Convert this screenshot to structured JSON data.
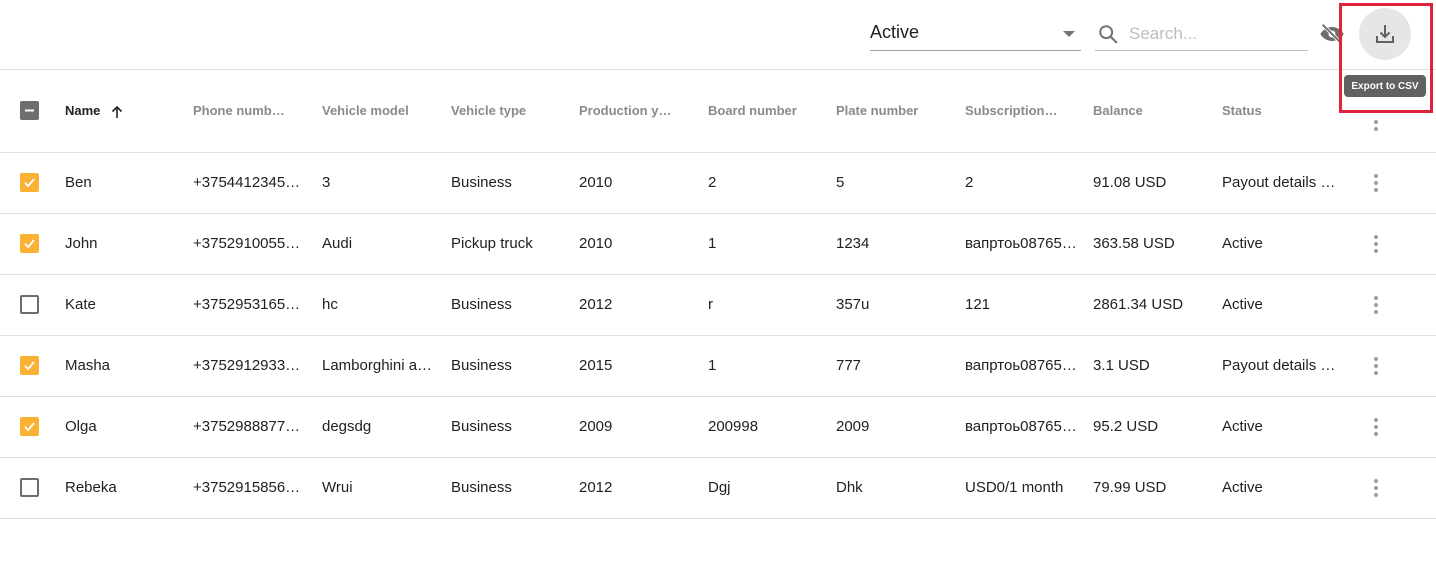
{
  "toolbar": {
    "status_filter": {
      "value": "Active"
    },
    "search": {
      "placeholder": "Search...",
      "value": ""
    },
    "hide_columns_icon": "eye-off-icon",
    "export_icon": "download-icon",
    "export_tooltip": "Export to CSV",
    "highlight_color": "#e0223a"
  },
  "table": {
    "columns": [
      "Name",
      "Phone numb…",
      "Vehicle model",
      "Vehicle type",
      "Production y…",
      "Board number",
      "Plate number",
      "Subscription…",
      "Balance",
      "Status"
    ],
    "sort": {
      "column": "Name",
      "direction": "ascending"
    },
    "select_all_state": "indeterminate",
    "checkbox_color": "#f9b233",
    "rows": [
      {
        "selected": true,
        "name": "Ben",
        "phone": "+3754412345…",
        "model": "3",
        "type": "Business",
        "year": "2010",
        "board": "2",
        "plate": "5",
        "subscription": "2",
        "balance": "91.08 USD",
        "status": "Payout details …"
      },
      {
        "selected": true,
        "name": "John",
        "phone": "+3752910055…",
        "model": "Audi",
        "type": "Pickup truck",
        "year": "2010",
        "board": "1",
        "plate": "1234",
        "subscription": "вапртоь08765…",
        "balance": "363.58 USD",
        "status": "Active"
      },
      {
        "selected": false,
        "name": "Kate",
        "phone": "+3752953165…",
        "model": "hc",
        "type": "Business",
        "year": "2012",
        "board": "r",
        "plate": "357u",
        "subscription": "121",
        "balance": "2861.34 USD",
        "status": "Active"
      },
      {
        "selected": true,
        "name": "Masha",
        "phone": "+3752912933…",
        "model": "Lamborghini a…",
        "type": "Business",
        "year": "2015",
        "board": "1",
        "plate": "777",
        "subscription": "вапртоь08765…",
        "balance": "3.1 USD",
        "status": "Payout details …"
      },
      {
        "selected": true,
        "name": "Olga",
        "phone": "+3752988877…",
        "model": "degsdg",
        "type": "Business",
        "year": "2009",
        "board": "200998",
        "plate": "2009",
        "subscription": "вапртоь08765…",
        "balance": "95.2 USD",
        "status": "Active"
      },
      {
        "selected": false,
        "name": "Rebeka",
        "phone": "+3752915856…",
        "model": "Wrui",
        "type": "Business",
        "year": "2012",
        "board": "Dgj",
        "plate": "Dhk",
        "subscription": "USD0/1 month",
        "balance": "79.99 USD",
        "status": "Active"
      }
    ]
  }
}
